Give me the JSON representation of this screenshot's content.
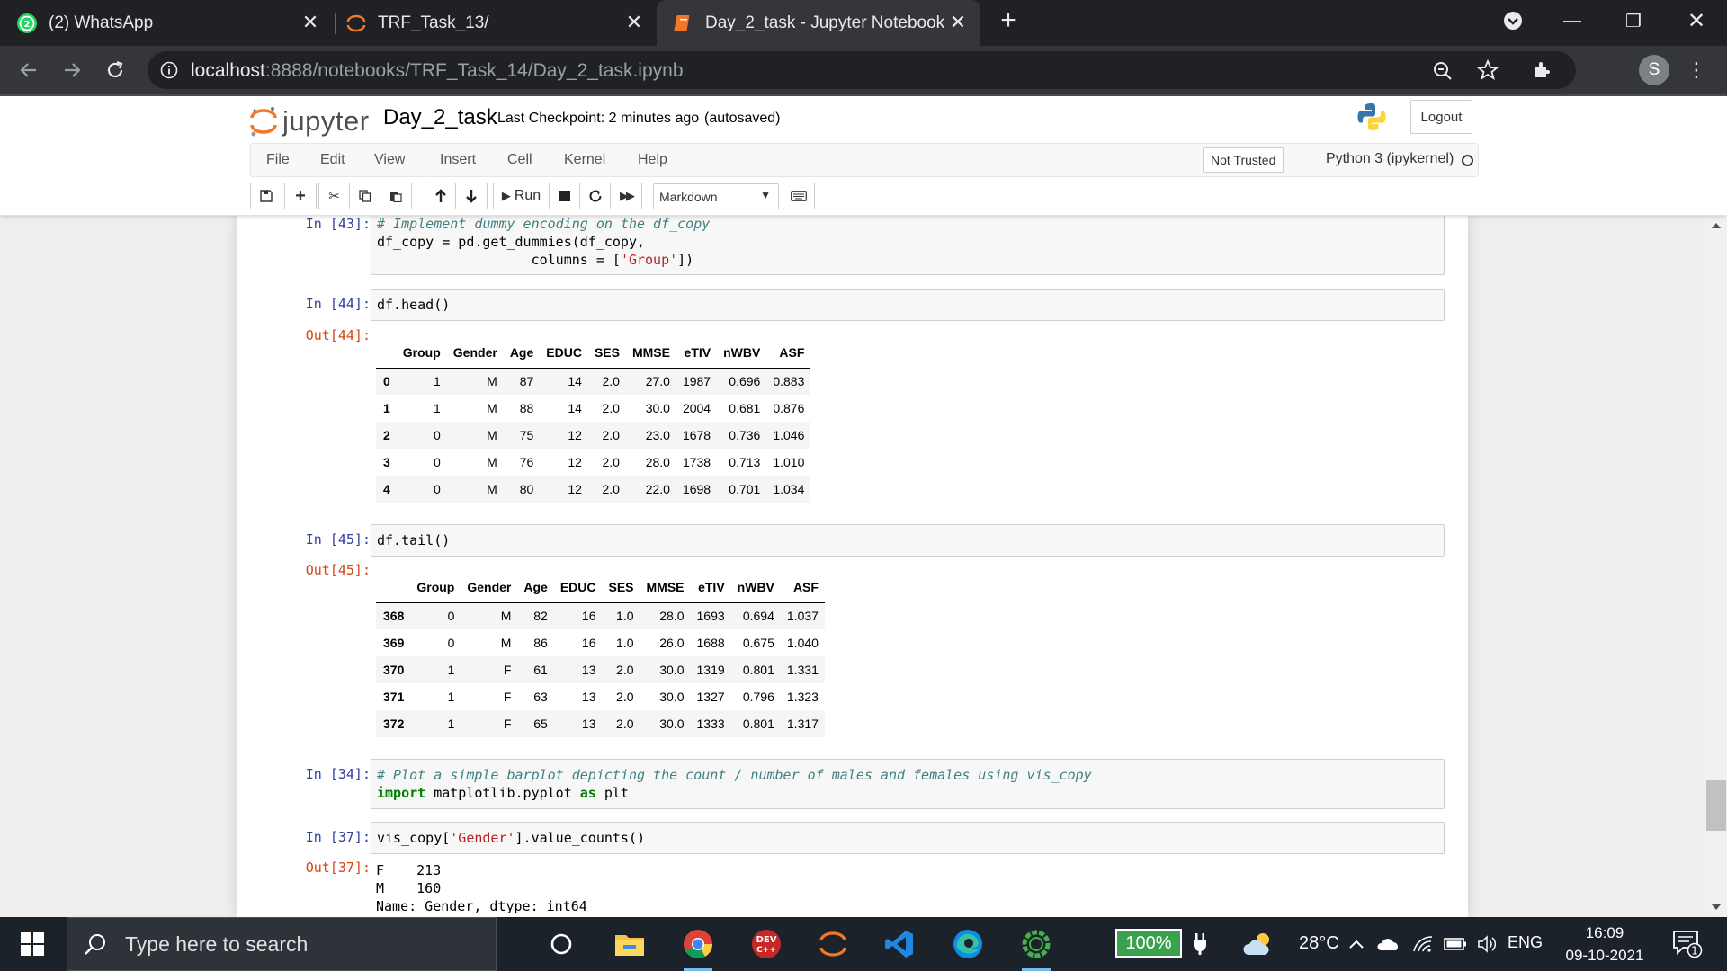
{
  "browser": {
    "tabs": [
      {
        "title": "(2) WhatsApp",
        "badge": "2"
      },
      {
        "title": "TRF_Task_13/"
      },
      {
        "title": "Day_2_task - Jupyter Notebook"
      }
    ],
    "url_host": "localhost",
    "url_path": ":8888/notebooks/TRF_Task_14/Day_2_task.ipynb",
    "profile_initial": "S"
  },
  "jupyter": {
    "logo_text": "jupyter",
    "notebook_name": "Day_2_task",
    "checkpoint": "Last Checkpoint: 2 minutes ago",
    "autosave": "(autosaved)",
    "logout_label": "Logout",
    "menu": [
      "File",
      "Edit",
      "View",
      "Insert",
      "Cell",
      "Kernel",
      "Help"
    ],
    "trust_label": "Not Trusted",
    "kernel_label": "Python 3 (ipykernel)",
    "run_label": "Run",
    "cell_type": "Markdown"
  },
  "cells": {
    "c43": {
      "prompt": "In [43]:",
      "line1_comment": "# Implement dummy encoding on the df_copy",
      "line2": "df_copy = pd.get_dummies(df_copy,",
      "line3_pre": "                   columns = [",
      "line3_str": "'Group'",
      "line3_post": "])"
    },
    "c44": {
      "prompt": "In [44]:",
      "code": "df.head()",
      "out_prompt": "Out[44]:"
    },
    "c45": {
      "prompt": "In [45]:",
      "code": "df.tail()",
      "out_prompt": "Out[45]:"
    },
    "c34": {
      "prompt": "In [34]:",
      "line1_comment": "# Plot a simple barplot depicting the count / number of males and females using vis_copy",
      "line2_kw1": "import",
      "line2_mid": " matplotlib.pyplot ",
      "line2_kw2": "as",
      "line2_post": " plt"
    },
    "c37": {
      "prompt": "In [37]:",
      "code_pre": "vis_copy[",
      "code_str": "'Gender'",
      "code_post": "].value_counts()",
      "out_prompt": "Out[37]:",
      "out_lines": [
        "F    213",
        "M    160",
        "Name: Gender, dtype: int64"
      ]
    }
  },
  "head_table": {
    "columns": [
      "",
      "Group",
      "Gender",
      "Age",
      "EDUC",
      "SES",
      "MMSE",
      "eTIV",
      "nWBV",
      "ASF"
    ],
    "rows": [
      [
        "0",
        "1",
        "M",
        "87",
        "14",
        "2.0",
        "27.0",
        "1987",
        "0.696",
        "0.883"
      ],
      [
        "1",
        "1",
        "M",
        "88",
        "14",
        "2.0",
        "30.0",
        "2004",
        "0.681",
        "0.876"
      ],
      [
        "2",
        "0",
        "M",
        "75",
        "12",
        "2.0",
        "23.0",
        "1678",
        "0.736",
        "1.046"
      ],
      [
        "3",
        "0",
        "M",
        "76",
        "12",
        "2.0",
        "28.0",
        "1738",
        "0.713",
        "1.010"
      ],
      [
        "4",
        "0",
        "M",
        "80",
        "12",
        "2.0",
        "22.0",
        "1698",
        "0.701",
        "1.034"
      ]
    ]
  },
  "tail_table": {
    "columns": [
      "",
      "Group",
      "Gender",
      "Age",
      "EDUC",
      "SES",
      "MMSE",
      "eTIV",
      "nWBV",
      "ASF"
    ],
    "rows": [
      [
        "368",
        "0",
        "M",
        "82",
        "16",
        "1.0",
        "28.0",
        "1693",
        "0.694",
        "1.037"
      ],
      [
        "369",
        "0",
        "M",
        "86",
        "16",
        "1.0",
        "26.0",
        "1688",
        "0.675",
        "1.040"
      ],
      [
        "370",
        "1",
        "F",
        "61",
        "13",
        "2.0",
        "30.0",
        "1319",
        "0.801",
        "1.331"
      ],
      [
        "371",
        "1",
        "F",
        "63",
        "13",
        "2.0",
        "30.0",
        "1327",
        "0.796",
        "1.323"
      ],
      [
        "372",
        "1",
        "F",
        "65",
        "13",
        "2.0",
        "30.0",
        "1333",
        "0.801",
        "1.317"
      ]
    ]
  },
  "taskbar": {
    "search_placeholder": "Type here to search",
    "battery": "100%",
    "temperature": "28°C",
    "language": "ENG",
    "time": "16:09",
    "date": "09-10-2021",
    "notification_count": "1"
  },
  "colors": {
    "jupyter_orange": "#f37726",
    "in_prompt": "#303f9f",
    "out_prompt": "#d84315"
  }
}
